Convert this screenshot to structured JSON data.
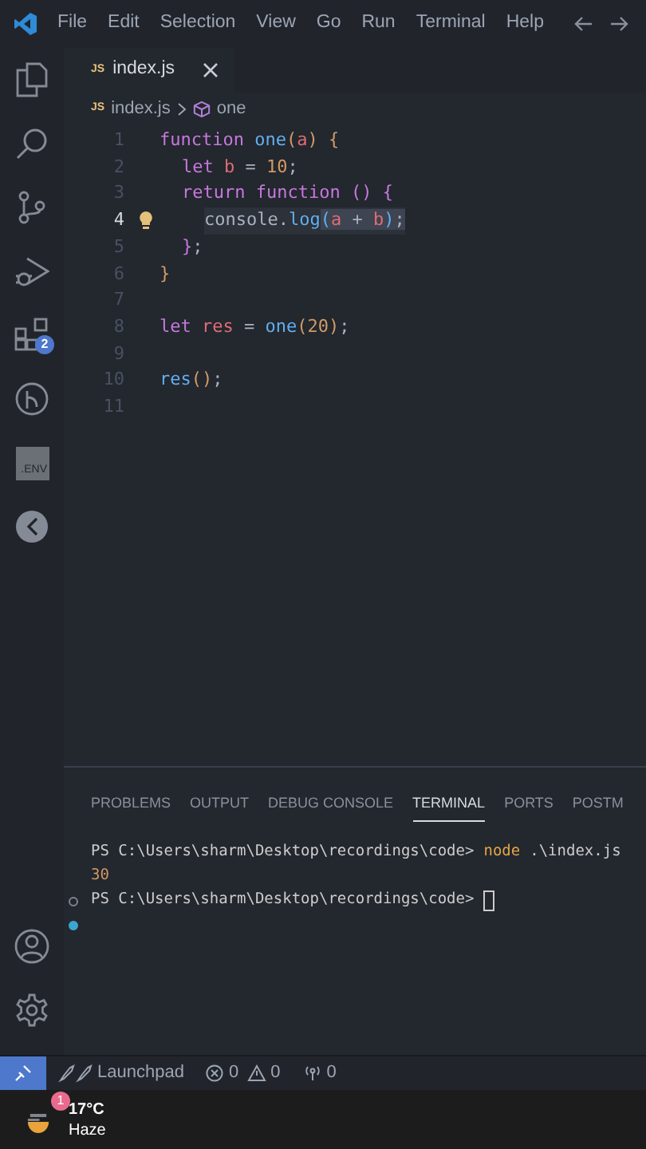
{
  "menu": [
    "File",
    "Edit",
    "Selection",
    "View",
    "Go",
    "Run",
    "Terminal",
    "Help"
  ],
  "activity_bar": {
    "items": [
      {
        "kind": "files"
      },
      {
        "kind": "search"
      },
      {
        "kind": "source-control"
      },
      {
        "kind": "run-debug"
      },
      {
        "kind": "extensions",
        "badge": "2"
      },
      {
        "kind": "git-graph"
      },
      {
        "kind": "env",
        "text": ".ENV"
      },
      {
        "kind": "arrow"
      }
    ],
    "bottom": [
      {
        "kind": "account"
      },
      {
        "kind": "settings"
      }
    ]
  },
  "tabs": [
    {
      "icon_text": "JS",
      "label": "index.js",
      "selected": true
    }
  ],
  "breadcrumb": {
    "icon_text": "JS",
    "file": "index.js",
    "symbol": "one"
  },
  "code": [
    {
      "number": "1",
      "active": false,
      "tokens": [
        {
          "kind": "keyword",
          "text": "function "
        },
        {
          "kind": "fn",
          "text": "one"
        },
        {
          "kind": "paren",
          "text": "("
        },
        {
          "kind": "var",
          "text": "a"
        },
        {
          "kind": "paren",
          "text": ") {"
        }
      ],
      "children": [
        {
          "number": "2",
          "active": false,
          "tokens": [
            {
              "kind": "keyword",
              "text": "let "
            },
            {
              "kind": "var",
              "text": "b"
            },
            {
              "kind": "plain",
              "text": " = "
            },
            {
              "kind": "num",
              "text": "10"
            },
            {
              "kind": "plain",
              "text": ";"
            }
          ]
        },
        {
          "number": "3",
          "active": false,
          "tokens": [
            {
              "kind": "keyword",
              "text": "return "
            },
            {
              "kind": "keyword",
              "text": "function "
            },
            {
              "kind": "paren2",
              "text": "() {"
            }
          ],
          "children": [
            {
              "number": "4",
              "active": true,
              "tokens": [
                {
                  "kind": "plain",
                  "text": "console",
                  "selected": false
                },
                {
                  "kind": "plain",
                  "text": ".",
                  "selected": false
                },
                {
                  "kind": "fn",
                  "text": "log",
                  "selected": false
                },
                {
                  "kind": "paren3",
                  "text": "(",
                  "selected": true
                },
                {
                  "kind": "var",
                  "text": "a",
                  "selected": true
                },
                {
                  "kind": "plain",
                  "text": " + ",
                  "selected": true
                },
                {
                  "kind": "var",
                  "text": "b",
                  "selected": true
                },
                {
                  "kind": "paren3",
                  "text": ")",
                  "selected": true
                },
                {
                  "kind": "plain",
                  "text": ";",
                  "selected": true
                }
              ]
            }
          ]
        },
        {
          "number": "5",
          "active": false,
          "tokens": [
            {
              "kind": "paren2",
              "text": "}"
            },
            {
              "kind": "plain",
              "text": ";"
            }
          ]
        }
      ]
    },
    {
      "number": "6",
      "active": false,
      "tokens": [
        {
          "kind": "paren",
          "text": "}"
        }
      ]
    },
    {
      "number": "7",
      "active": false
    },
    {
      "number": "8",
      "active": false,
      "tokens": [
        {
          "kind": "keyword",
          "text": "let "
        },
        {
          "kind": "var",
          "text": "res"
        },
        {
          "kind": "plain",
          "text": " = "
        },
        {
          "kind": "fn",
          "text": "one"
        },
        {
          "kind": "paren",
          "text": "("
        },
        {
          "kind": "num",
          "text": "20"
        },
        {
          "kind": "paren",
          "text": ")"
        },
        {
          "kind": "plain",
          "text": ";"
        }
      ]
    },
    {
      "number": "9",
      "active": false
    },
    {
      "number": "10",
      "active": false,
      "tokens": [
        {
          "kind": "fn",
          "text": "res"
        },
        {
          "kind": "paren",
          "text": "()"
        },
        {
          "kind": "plain",
          "text": ";"
        }
      ]
    },
    {
      "number": "11",
      "active": false
    }
  ],
  "panel": {
    "tabs": [
      {
        "label": "PROBLEMS",
        "selected": false
      },
      {
        "label": "OUTPUT",
        "selected": false
      },
      {
        "label": "DEBUG CONSOLE",
        "selected": false
      },
      {
        "label": "TERMINAL",
        "selected": true
      },
      {
        "label": "PORTS",
        "selected": false
      },
      {
        "label": "POSTM",
        "selected": false
      }
    ],
    "terminal": [
      {
        "kind": "command",
        "prompt": "PS C:\\Users\\sharm\\Desktop\\recordings\\code>",
        "command": "node",
        "args": ".\\index.js"
      },
      {
        "kind": "output",
        "text": "30"
      },
      {
        "kind": "prompt",
        "prompt": "PS C:\\Users\\sharm\\Desktop\\recordings\\code>"
      },
      {
        "kind": "marker"
      }
    ]
  },
  "status_bar": {
    "launchpad": "Launchpad",
    "errors": "0",
    "warnings": "0",
    "ports": "0"
  },
  "taskbar": {
    "badge": "1",
    "temperature": "17°C",
    "condition": "Haze"
  }
}
